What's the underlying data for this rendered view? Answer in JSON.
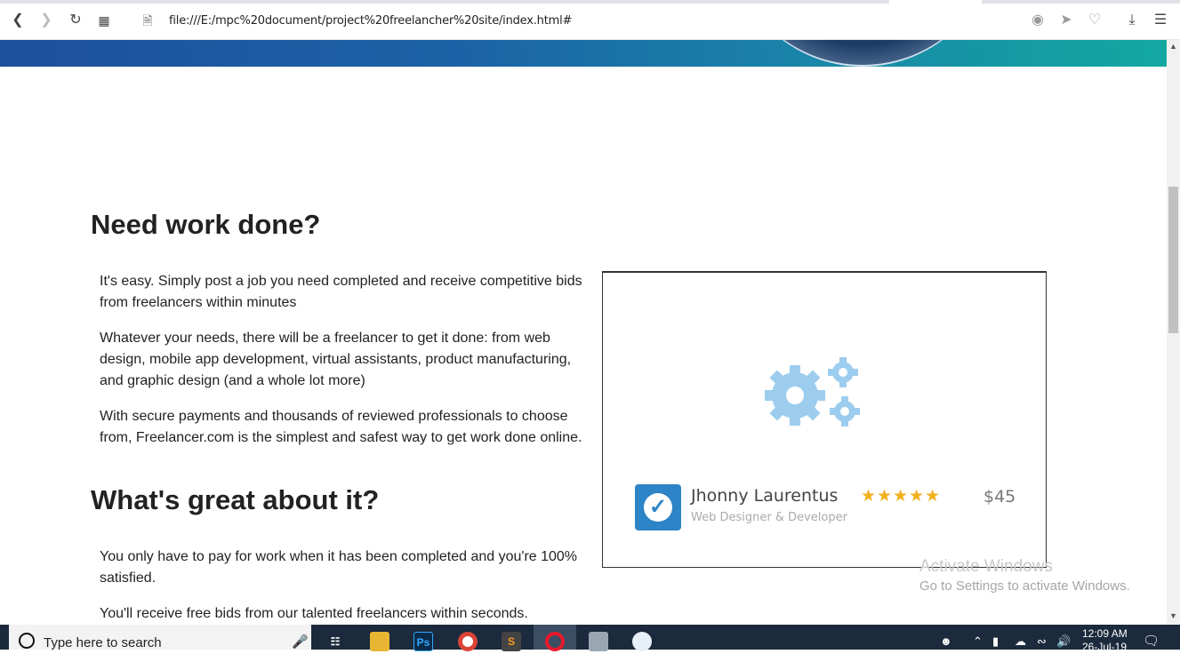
{
  "browser": {
    "url": "file:///E:/mpc%20document/project%20freelancher%20site/index.html#"
  },
  "page": {
    "section1": {
      "heading": "Need work done?",
      "paragraphs": [
        "It's easy. Simply post a job you need completed and receive competitive bids from freelancers within minutes",
        "Whatever your needs, there will be a freelancer to get it done: from web design, mobile app development, virtual assistants, product manufacturing, and graphic design (and a whole lot more)",
        "With secure payments and thousands of reviewed professionals to choose from, Freelancer.com is the simplest and safest way to get work done online."
      ]
    },
    "section2": {
      "heading": "What's great about it?",
      "paragraphs": [
        "You only have to pay for work when it has been completed and you're 100% satisfied.",
        "You'll receive free bids from our talented freelancers within seconds."
      ]
    },
    "card": {
      "name": "Jhonny Laurentus",
      "role": "Web Designer & Developer",
      "stars": "★★★★★",
      "rating": 5,
      "price": "$45"
    }
  },
  "watermark": {
    "line1": "Activate Windows",
    "line2": "Go to Settings to activate Windows."
  },
  "taskbar": {
    "search_placeholder": "Type here to search",
    "time": "12:09 AM",
    "date": "26-Jul-19"
  },
  "colors": {
    "banner_start": "#1e4f9c",
    "banner_end": "#12a9a1",
    "gear": "#9dcdee",
    "avatar": "#2d84c6",
    "stars": "#f2b01e",
    "taskbar": "#1b2a3c"
  }
}
